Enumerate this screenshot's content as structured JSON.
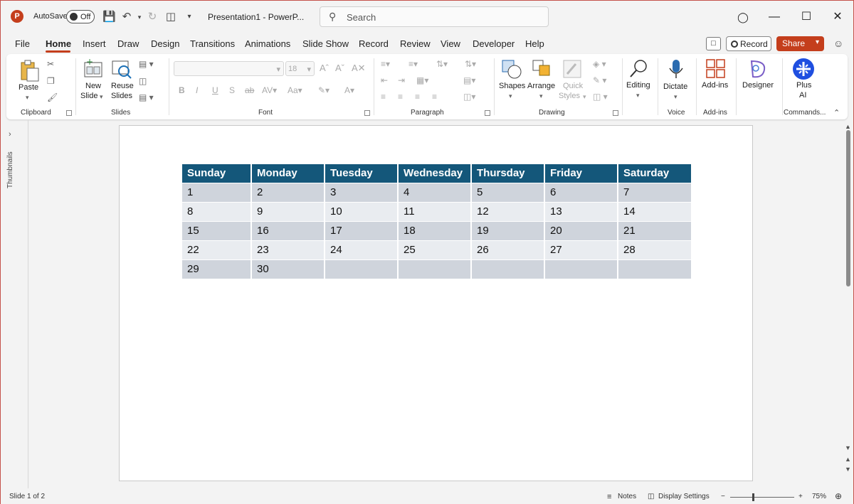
{
  "titlebar": {
    "autosave_label": "AutoSave",
    "autosave_state": "Off",
    "doc_title": "Presentation1 - PowerP...",
    "search_placeholder": "Search"
  },
  "tabs": [
    "File",
    "Home",
    "Insert",
    "Draw",
    "Design",
    "Transitions",
    "Animations",
    "Slide Show",
    "Record",
    "Review",
    "View",
    "Developer",
    "Help"
  ],
  "active_tab": "Home",
  "header_buttons": {
    "record": "Record",
    "share": "Share"
  },
  "ribbon": {
    "clipboard": {
      "label": "Clipboard",
      "paste": "Paste"
    },
    "slides": {
      "label": "Slides",
      "new_slide_1": "New",
      "new_slide_2": "Slide",
      "reuse_1": "Reuse",
      "reuse_2": "Slides"
    },
    "font": {
      "label": "Font",
      "size_value": "18"
    },
    "paragraph": {
      "label": "Paragraph"
    },
    "drawing": {
      "label": "Drawing",
      "shapes": "Shapes",
      "arrange": "Arrange",
      "quick_1": "Quick",
      "quick_2": "Styles"
    },
    "editing": {
      "label": "Editing"
    },
    "voice": {
      "label": "Voice",
      "dictate": "Dictate"
    },
    "addins": {
      "label": "Add-ins",
      "addins_btn": "Add-ins"
    },
    "designer": {
      "label": "Designer"
    },
    "commands": {
      "label": "Commands...",
      "plus_1": "Plus",
      "plus_2": "AI"
    }
  },
  "left_pane": {
    "thumbnails": "Thumbnails"
  },
  "calendar": {
    "headers": [
      "Sunday",
      "Monday",
      "Tuesday",
      "Wednesday",
      "Thursday",
      "Friday",
      "Saturday"
    ],
    "rows": [
      [
        "1",
        "2",
        "3",
        "4",
        "5",
        "6",
        "7"
      ],
      [
        "8",
        "9",
        "10",
        "11",
        "12",
        "13",
        "14"
      ],
      [
        "15",
        "16",
        "17",
        "18",
        "19",
        "20",
        "21"
      ],
      [
        "22",
        "23",
        "24",
        "25",
        "26",
        "27",
        "28"
      ],
      [
        "29",
        "30",
        "",
        "",
        "",
        "",
        ""
      ]
    ],
    "header_color": "#14577a"
  },
  "statusbar": {
    "slide_info": "Slide 1 of 2",
    "notes": "Notes",
    "display_settings": "Display Settings",
    "zoom": "75%"
  },
  "colors": {
    "accent": "#c43e1c"
  }
}
